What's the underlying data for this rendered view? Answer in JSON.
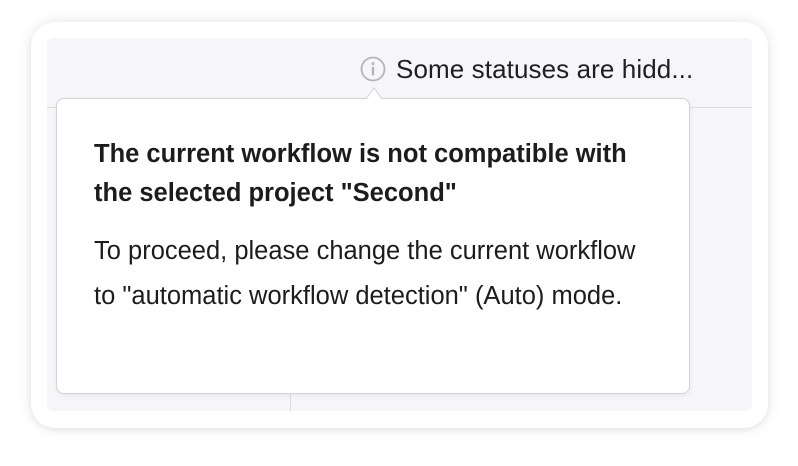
{
  "header": {
    "status_text": "Some statuses are hidd..."
  },
  "tooltip": {
    "title": "The current workflow is not compatible with the selected project \"Second\"",
    "body": "To proceed, please change the current workflow to \"automatic workflow detection\" (Auto) mode."
  },
  "icons": {
    "info": "info-circle-icon"
  },
  "colors": {
    "panel_background": "#f6f6f9",
    "divider": "#dcdce2",
    "icon_gray": "#b4b4bb",
    "text": "#1c1c1c",
    "tooltip_border": "#d3d3d8"
  }
}
